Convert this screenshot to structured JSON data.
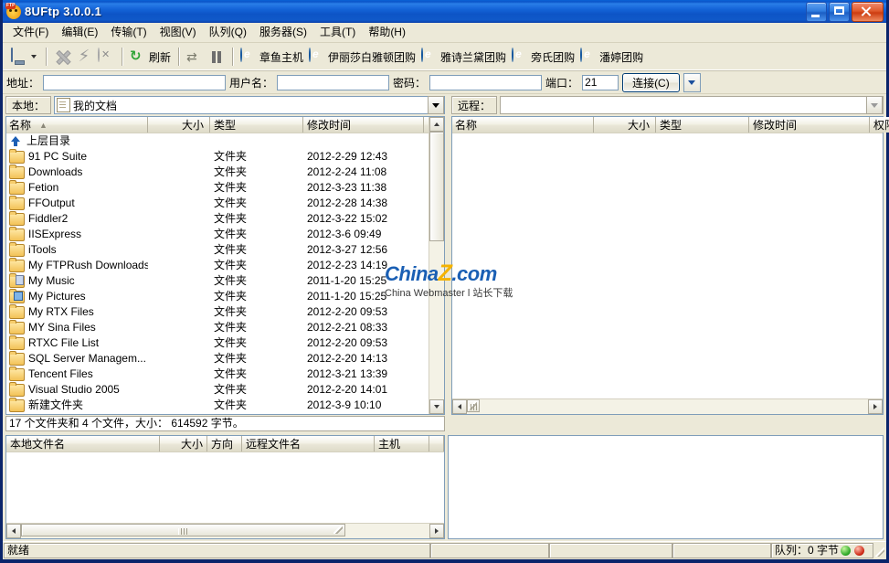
{
  "window": {
    "title": "8UFtp 3.0.0.1",
    "icon": "ftp-app-icon",
    "minimize": "_",
    "maximize": "□",
    "close": "✕"
  },
  "menu": [
    {
      "label": "文件(F)",
      "name": "menu-file"
    },
    {
      "label": "编辑(E)",
      "name": "menu-edit"
    },
    {
      "label": "传输(T)",
      "name": "menu-transfer"
    },
    {
      "label": "视图(V)",
      "name": "menu-view"
    },
    {
      "label": "队列(Q)",
      "name": "menu-queue"
    },
    {
      "label": "服务器(S)",
      "name": "menu-server"
    },
    {
      "label": "工具(T)",
      "name": "menu-tools"
    },
    {
      "label": "帮助(H)",
      "name": "menu-help"
    }
  ],
  "toolbar": {
    "site_manager": "",
    "refresh_label": "刷新",
    "links": [
      {
        "label": "章鱼主机"
      },
      {
        "label": "伊丽莎白雅顿团购"
      },
      {
        "label": "雅诗兰黛团购"
      },
      {
        "label": "旁氏团购"
      },
      {
        "label": "潘婷团购"
      }
    ]
  },
  "connect": {
    "address_label": "地址：",
    "address_value": "",
    "address_placeholder": "",
    "user_label": "用户名：",
    "user_value": "",
    "password_label": "密码：",
    "password_value": "",
    "port_label": "端口：",
    "port_value": "21",
    "connect_button": "连接(C)"
  },
  "local": {
    "path_label": "本地：",
    "path_value": "我的文档",
    "columns": [
      {
        "label": "名称",
        "sort": "▲"
      },
      {
        "label": "大小"
      },
      {
        "label": "类型"
      },
      {
        "label": "修改时间"
      }
    ],
    "parent_row": {
      "name": "上层目录"
    },
    "rows": [
      {
        "name": "91 PC Suite",
        "size": "",
        "type": "文件夹",
        "date": "2012-2-29 12:43",
        "icon": "folder"
      },
      {
        "name": "Downloads",
        "size": "",
        "type": "文件夹",
        "date": "2012-2-24 11:08",
        "icon": "folder"
      },
      {
        "name": "Fetion",
        "size": "",
        "type": "文件夹",
        "date": "2012-3-23 11:38",
        "icon": "folder"
      },
      {
        "name": "FFOutput",
        "size": "",
        "type": "文件夹",
        "date": "2012-2-28 14:38",
        "icon": "folder"
      },
      {
        "name": "Fiddler2",
        "size": "",
        "type": "文件夹",
        "date": "2012-3-22 15:02",
        "icon": "folder"
      },
      {
        "name": "IISExpress",
        "size": "",
        "type": "文件夹",
        "date": "2012-3-6 09:49",
        "icon": "folder"
      },
      {
        "name": "iTools",
        "size": "",
        "type": "文件夹",
        "date": "2012-3-27 12:56",
        "icon": "folder"
      },
      {
        "name": "My FTPRush Downloads",
        "size": "",
        "type": "文件夹",
        "date": "2012-2-23 14:19",
        "icon": "folder"
      },
      {
        "name": "My Music",
        "size": "",
        "type": "文件夹",
        "date": "2011-1-20 15:25",
        "icon": "folder-music"
      },
      {
        "name": "My Pictures",
        "size": "",
        "type": "文件夹",
        "date": "2011-1-20 15:25",
        "icon": "folder-pictures"
      },
      {
        "name": "My RTX Files",
        "size": "",
        "type": "文件夹",
        "date": "2012-2-20 09:53",
        "icon": "folder"
      },
      {
        "name": "MY Sina Files",
        "size": "",
        "type": "文件夹",
        "date": "2012-2-21 08:33",
        "icon": "folder"
      },
      {
        "name": "RTXC File List",
        "size": "",
        "type": "文件夹",
        "date": "2012-2-20 09:53",
        "icon": "folder"
      },
      {
        "name": "SQL Server Managem...",
        "size": "",
        "type": "文件夹",
        "date": "2012-2-20 14:13",
        "icon": "folder"
      },
      {
        "name": "Tencent Files",
        "size": "",
        "type": "文件夹",
        "date": "2012-3-21 13:39",
        "icon": "folder"
      },
      {
        "name": "Visual Studio 2005",
        "size": "",
        "type": "文件夹",
        "date": "2012-2-20 14:01",
        "icon": "folder"
      },
      {
        "name": "新建文件夹",
        "size": "",
        "type": "文件夹",
        "date": "2012-3-9 10:10",
        "icon": "folder"
      }
    ],
    "status": "17 个文件夹和 4 个文件，大小： 614592 字节。"
  },
  "remote": {
    "path_label": "远程：",
    "path_value": "",
    "columns": [
      {
        "label": "名称"
      },
      {
        "label": "大小"
      },
      {
        "label": "类型"
      },
      {
        "label": "修改时间"
      },
      {
        "label": "权限"
      }
    ],
    "rows": []
  },
  "queue": {
    "local_columns": [
      {
        "label": "本地文件名"
      },
      {
        "label": "大小"
      },
      {
        "label": "方向"
      },
      {
        "label": "远程文件名"
      },
      {
        "label": "主机"
      }
    ],
    "rows": []
  },
  "statusbar": {
    "message": "就绪",
    "field1": "",
    "field2": "",
    "field3": "",
    "queue_label": "队列：0 字节",
    "led_green": "#2faa28",
    "led_red": "#cf2a17"
  },
  "watermark": {
    "brand_a": "China",
    "brand_z": "Z",
    "brand_b": ".com",
    "subtitle": "China Webmaster l 站长下载"
  },
  "colors": {
    "title_blue": "#0b55c9",
    "window_face": "#ece9d8",
    "border_blue": "#0a246a",
    "field_border": "#7f9db9"
  }
}
